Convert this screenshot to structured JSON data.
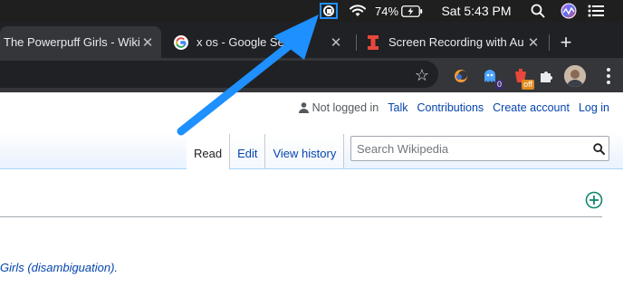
{
  "menubar": {
    "battery_percent": "74%",
    "clock": "Sat 5:43 PM"
  },
  "tabs": [
    {
      "title": "The Powerpuff Girls - Wiki",
      "favicon": "wikipedia-icon"
    },
    {
      "title": "x os - Google Se",
      "favicon": "google-icon"
    },
    {
      "title": "Screen Recording with Au",
      "favicon": "recording-app-icon"
    }
  ],
  "new_tab_label": "+",
  "extensions": {
    "ghost_badge": "0",
    "off_badge": "off"
  },
  "wikipedia": {
    "user_status": "Not logged in",
    "links": [
      "Talk",
      "Contributions",
      "Create account",
      "Log in"
    ],
    "view_tabs": [
      "Read",
      "Edit",
      "View history"
    ],
    "search_placeholder": "Search Wikipedia",
    "hatnote": "Girls (disambiguation)."
  },
  "colors": {
    "highlight": "#1e90ff",
    "arrow": "#1e90ff",
    "link": "#0645ad",
    "green_plus": "#14866d"
  }
}
